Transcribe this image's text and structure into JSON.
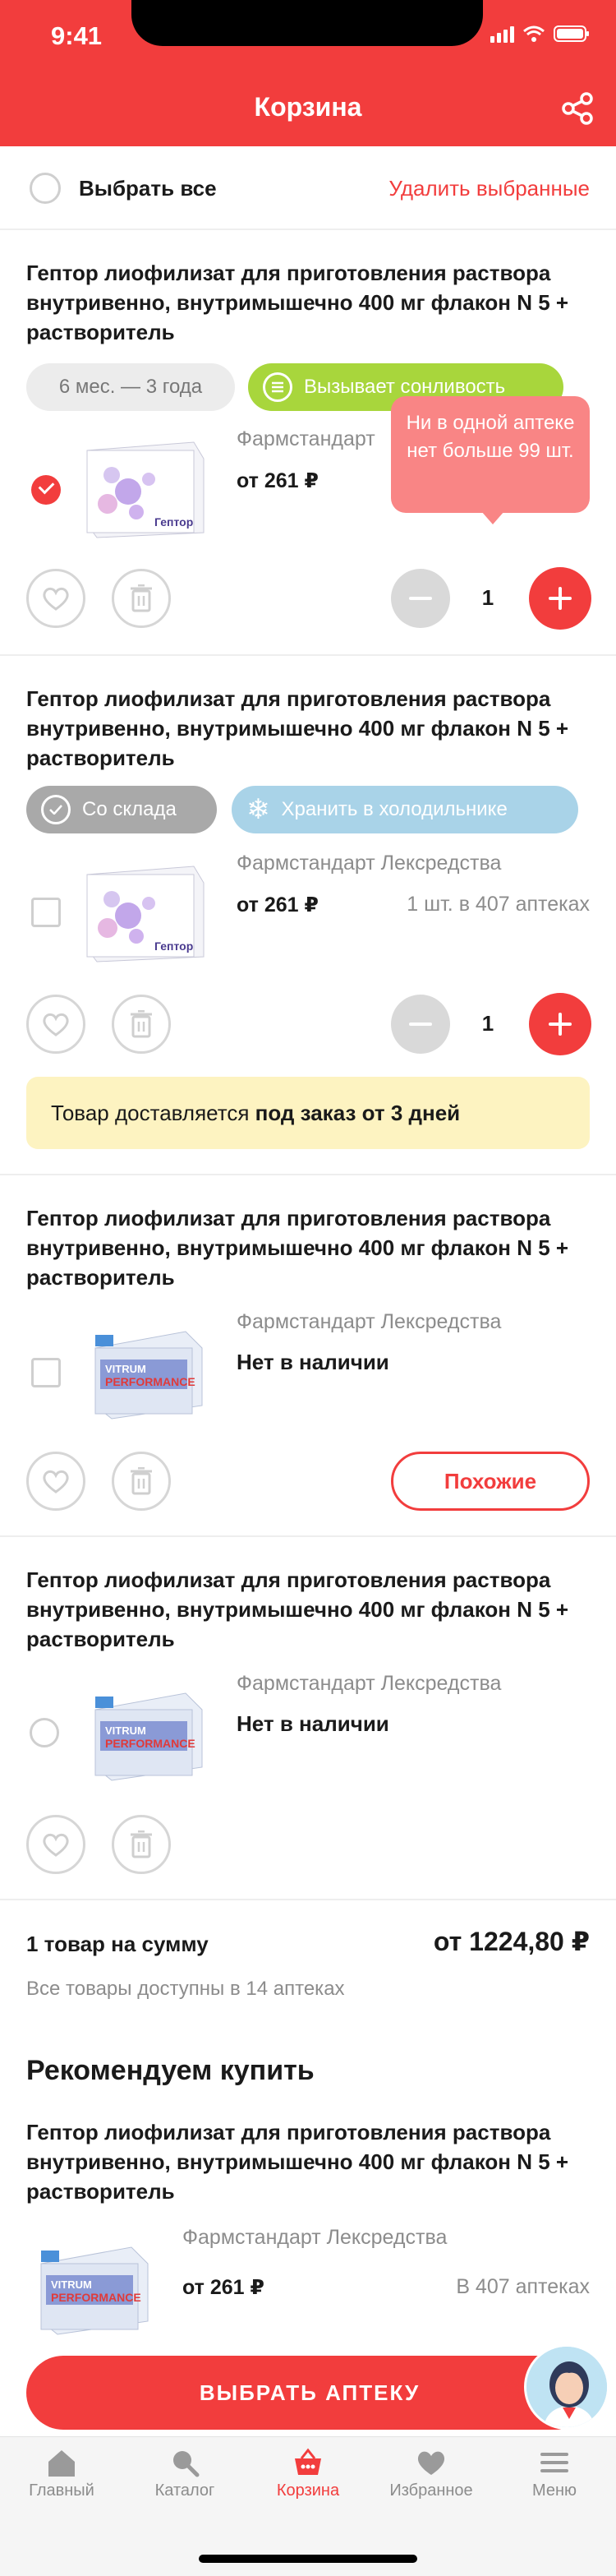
{
  "status_bar": {
    "time": "9:41"
  },
  "header": {
    "title": "Корзина"
  },
  "select_bar": {
    "select_all": "Выбрать все",
    "delete_selected": "Удалить выбранные"
  },
  "products": [
    {
      "title": "Гептор лиофилизат для приготовления раствора внутривенно, внутримышечно 400 мг флакон N 5 + растворитель",
      "tag_age": "6 мес. — 3 года",
      "tag_warning": "Вызывает сонливость",
      "maker": "Фармстандарт",
      "price": "от 261 ₽",
      "avail_partial": "1",
      "tooltip": "Ни в одной аптеке нет больше  99 шт.",
      "qty": "1",
      "box_label": "Гептор"
    },
    {
      "title": "Гептор лиофилизат для приготовления раствора внутривенно, внутримышечно 400 мг флакон N 5 + растворитель",
      "tag_stock": "Со склада",
      "tag_cold": "Хранить в холодильнике",
      "maker": "Фармстандарт Лексредства",
      "price": "от 261 ₽",
      "availability": "1 шт. в 407 аптеках",
      "qty": "1",
      "box_label": "Гептор",
      "notice_prefix": "Товар доставляется ",
      "notice_bold": "под заказ от 3 дней"
    },
    {
      "title": "Гептор лиофилизат для приготовления раствора внутривенно, внутримышечно 400 мг флакон N 5 + растворитель",
      "maker": "Фармстандарт Лексредства",
      "stock": "Нет в наличии",
      "similar": "Похожие"
    },
    {
      "title": "Гептор лиофилизат для приготовления раствора внутривенно, внутримышечно 400 мг флакон N 5 + растворитель",
      "maker": "Фармстандарт Лексредства",
      "stock": "Нет в наличии"
    }
  ],
  "summary": {
    "label": "1 товар на сумму",
    "total": "от 1224,80 ₽",
    "sub": "Все товары доступны в 14 аптеках"
  },
  "recommend": {
    "title": "Рекомендуем купить",
    "item": {
      "title": "Гептор лиофилизат для приготовления раствора внутривенно, внутримышечно 400 мг флакон N 5 + растворитель",
      "maker": "Фармстандарт Лексредства",
      "price": "от 261 ₽",
      "availability": "В 407 аптеках"
    }
  },
  "cta": {
    "label": "ВЫБРАТЬ АПТЕКУ"
  },
  "tabbar": [
    {
      "label": "Главный",
      "icon": "home-icon"
    },
    {
      "label": "Каталог",
      "icon": "search-icon"
    },
    {
      "label": "Корзина",
      "icon": "basket-icon"
    },
    {
      "label": "Избранное",
      "icon": "heart-icon"
    },
    {
      "label": "Меню",
      "icon": "menu-icon"
    }
  ],
  "colors": {
    "accent": "#f23d3d",
    "warning_chip": "#a8d63c",
    "cold_chip": "#a9d3e8",
    "notice_bg": "#fdf3c1"
  }
}
